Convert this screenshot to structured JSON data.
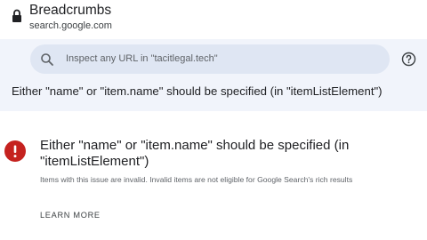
{
  "header": {
    "title": "Breadcrumbs",
    "url": "search.google.com",
    "lock_icon": "lock-icon"
  },
  "search": {
    "placeholder": "Inspect any URL in \"tacitlegal.tech\"",
    "icon": "search-icon"
  },
  "toolbar": {
    "help_icon": "help-icon"
  },
  "band": {
    "title": "Either \"name\" or \"item.name\" should be specified (in \"itemListElement\")"
  },
  "issue": {
    "icon": "error-icon",
    "icon_color": "#c5221f",
    "title": "Either \"name\" or \"item.name\" should be specified (in \"itemListElement\")",
    "description": "Items with this issue are invalid. Invalid items are not eligible for Google Search's rich results",
    "learn_more_label": "LEARN MORE"
  },
  "colors": {
    "band_background": "#f1f4fb",
    "search_background": "#dfe6f3",
    "error": "#c5221f"
  }
}
